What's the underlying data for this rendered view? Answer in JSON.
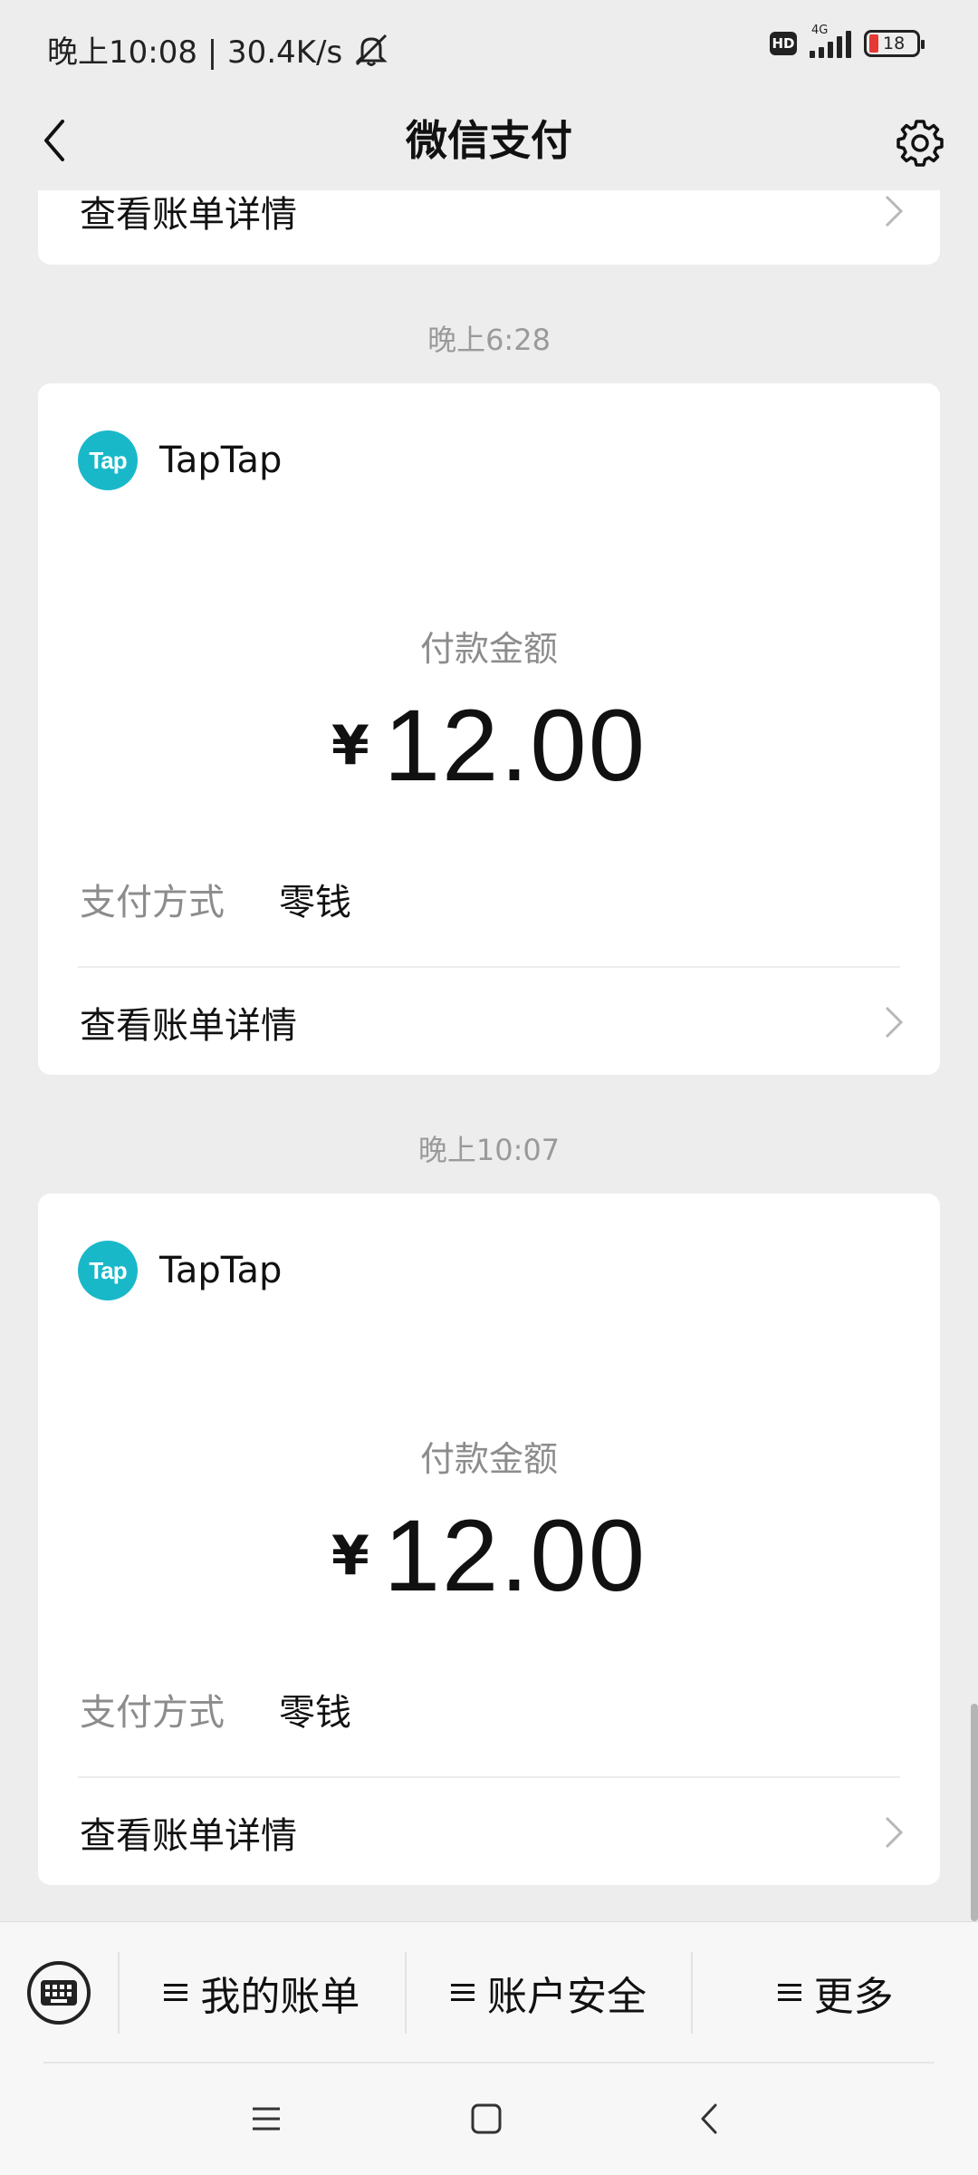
{
  "status_bar": {
    "time_speed": "晚上10:08 | 30.4K/s",
    "hd": "HD",
    "network": "4G",
    "battery": "18"
  },
  "nav": {
    "title": "微信支付"
  },
  "top_card": {
    "details_label": "查看账单详情"
  },
  "payments": [
    {
      "time": "晚上6:28",
      "merchant_logo_text": "Tap",
      "merchant_name": "TapTap",
      "amount_label": "付款金额",
      "currency": "¥",
      "amount": "12.00",
      "method_label": "支付方式",
      "method_value": "零钱",
      "details_label": "查看账单详情"
    },
    {
      "time": "晚上10:07",
      "merchant_logo_text": "Tap",
      "merchant_name": "TapTap",
      "amount_label": "付款金额",
      "currency": "¥",
      "amount": "12.00",
      "method_label": "支付方式",
      "method_value": "零钱",
      "details_label": "查看账单详情"
    }
  ],
  "bottom_menu": {
    "items": [
      "我的账单",
      "账户安全",
      "更多"
    ]
  },
  "colors": {
    "background": "#ededed",
    "card": "#ffffff",
    "logo": "#19b8c9",
    "muted_text": "#8c8c8c"
  },
  "icons": {
    "back": "back-arrow-icon",
    "settings": "gear-icon",
    "keyboard": "keyboard-icon",
    "chevron": "chevron-right-icon",
    "mute": "bell-muted-icon"
  }
}
